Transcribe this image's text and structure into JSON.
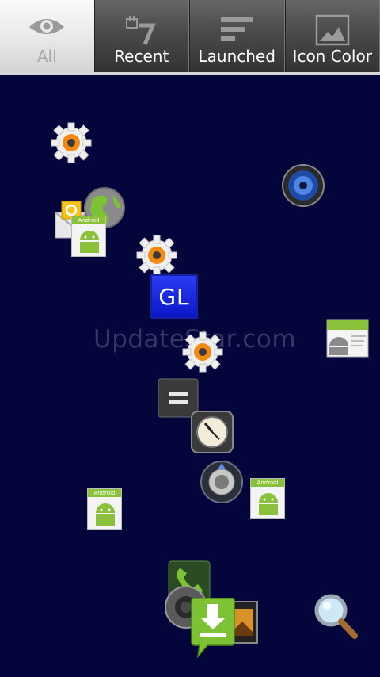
{
  "tabs": [
    {
      "label": "All",
      "icon": "eye-icon",
      "active": true
    },
    {
      "label": "Recent",
      "icon": "calendar-seven-icon",
      "active": false
    },
    {
      "label": "Launched",
      "icon": "bars-icon",
      "active": false
    },
    {
      "label": "Icon Color",
      "icon": "picture-icon",
      "active": false
    }
  ],
  "canvas": {
    "watermark": "UpdateStar.com",
    "gl_label": "GL",
    "android_card_label": "Android",
    "background_color": "#04053a"
  }
}
